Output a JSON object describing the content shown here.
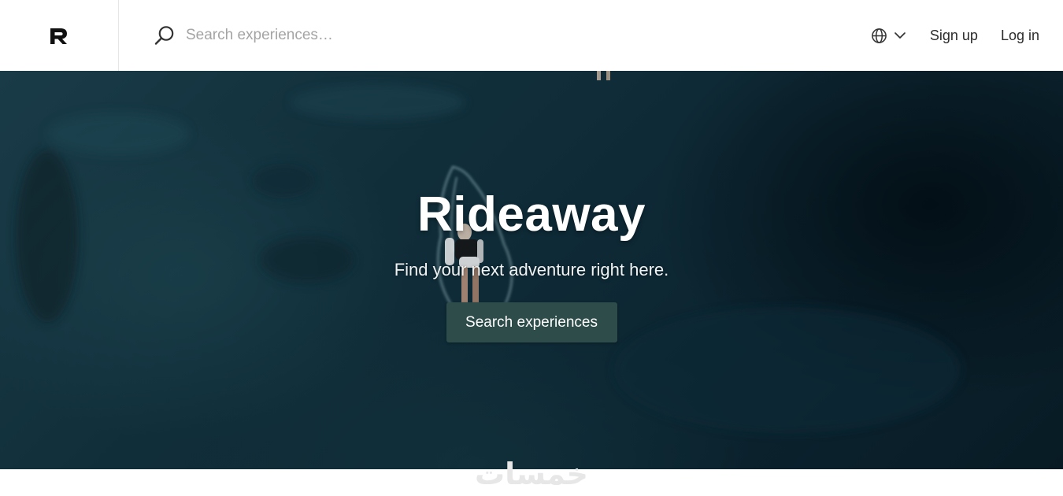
{
  "brand": {
    "logo_letter": "R",
    "logo_icon": "rideaway-r-logo"
  },
  "search": {
    "placeholder": "Search experiences…",
    "icon": "search-icon"
  },
  "nav": {
    "language_icon": "globe-icon",
    "language_chevron_icon": "chevron-down-icon",
    "signup_label": "Sign up",
    "login_label": "Log in"
  },
  "hero": {
    "title": "Rideaway",
    "subtitle": "Find your next adventure right here.",
    "cta_label": "Search experiences",
    "background": "aerial ocean photo with surfer"
  },
  "colors": {
    "cta_background": "#2e4d4a",
    "hero_dark": "#0d2733",
    "topbar_background": "#ffffff"
  },
  "watermark": {
    "text": "خمسات"
  }
}
